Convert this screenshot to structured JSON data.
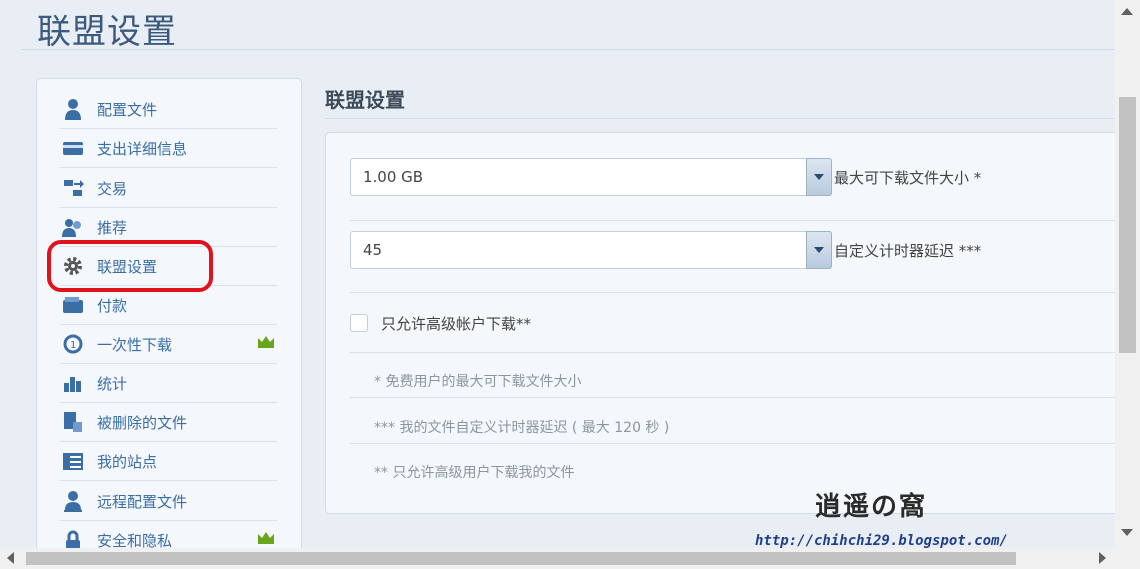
{
  "page": {
    "title": "联盟设置"
  },
  "sidebar": {
    "items": [
      {
        "label": "配置文件",
        "icon": "user-icon"
      },
      {
        "label": "支出详细信息",
        "icon": "card-icon"
      },
      {
        "label": "交易",
        "icon": "transactions-icon"
      },
      {
        "label": "推荐",
        "icon": "referral-icon"
      },
      {
        "label": "联盟设置",
        "icon": "gear-icon"
      },
      {
        "label": "付款",
        "icon": "wallet-icon"
      },
      {
        "label": "一次性下载",
        "icon": "one-time-download-icon",
        "premium": true
      },
      {
        "label": "统计",
        "icon": "stats-icon"
      },
      {
        "label": "被删除的文件",
        "icon": "deleted-files-icon"
      },
      {
        "label": "我的站点",
        "icon": "sites-icon"
      },
      {
        "label": "远程配置文件",
        "icon": "remote-profile-icon"
      },
      {
        "label": "安全和隐私",
        "icon": "lock-icon",
        "premium": true
      }
    ]
  },
  "main": {
    "title": "联盟设置",
    "max_download": {
      "value": "1.00 GB",
      "label": "最大可下载文件大小 *"
    },
    "timer_delay": {
      "value": "45",
      "label": "自定义计时器延迟 ***"
    },
    "premium_only": {
      "label": "只允许高级帐户下载**",
      "checked": false
    },
    "notes": [
      "* 免费用户的最大可下载文件大小",
      "*** 我的文件自定义计时器延迟 ( 最大 120 秒 )",
      "** 只允许高级用户下载我的文件"
    ]
  },
  "watermark": {
    "logo": "逍遥の窩",
    "url": "http://chihchi29.blogspot.com/"
  },
  "colors": {
    "link": "#3a6ea5",
    "highlight": "#e0131c",
    "crown": "#6aa51e",
    "icon": "#3a6ea5"
  }
}
